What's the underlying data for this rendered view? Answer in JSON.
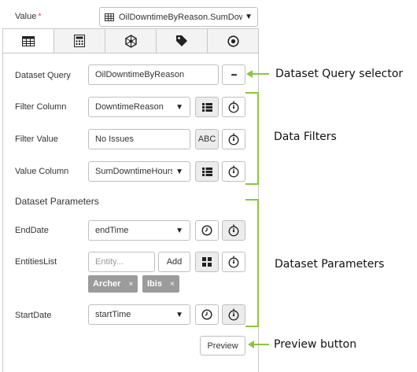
{
  "field": {
    "label": "Value",
    "required_mark": "*",
    "selected_value": "OilDowntimeByReason.SumDowntimeHours"
  },
  "tabs": [
    {
      "icon": "table-icon",
      "active": true
    },
    {
      "icon": "calculator-icon",
      "active": false
    },
    {
      "icon": "hexagon-network-icon",
      "active": false
    },
    {
      "icon": "tag-icon",
      "active": false
    },
    {
      "icon": "target-circle-icon",
      "active": false
    }
  ],
  "dataset_query": {
    "label": "Dataset Query",
    "value": "OilDowntimeByReason",
    "more_label": "•••"
  },
  "filter_column": {
    "label": "Filter Column",
    "value": "DowntimeReason"
  },
  "filter_value": {
    "label": "Filter Value",
    "value": "No Issues",
    "mode_label": "ABC"
  },
  "value_column": {
    "label": "Value Column",
    "value": "SumDowntimeHours"
  },
  "parameters": {
    "title": "Dataset Parameters",
    "end_date": {
      "label": "EndDate",
      "value": "endTime"
    },
    "entities_list": {
      "label": "EntitiesList",
      "placeholder": "Entity...",
      "add_label": "Add",
      "chips": [
        {
          "label": "Archer",
          "remove": "×"
        },
        {
          "label": "Ibis",
          "remove": "×"
        }
      ]
    },
    "start_date": {
      "label": "StartDate",
      "value": "startTime"
    }
  },
  "preview_label": "Preview",
  "annotations": {
    "dataset_query_selector": "Dataset Query selector",
    "data_filters": "Data Filters",
    "dataset_parameters": "Dataset Parameters",
    "preview_button": "Preview button",
    "color": "#8cc63f"
  }
}
